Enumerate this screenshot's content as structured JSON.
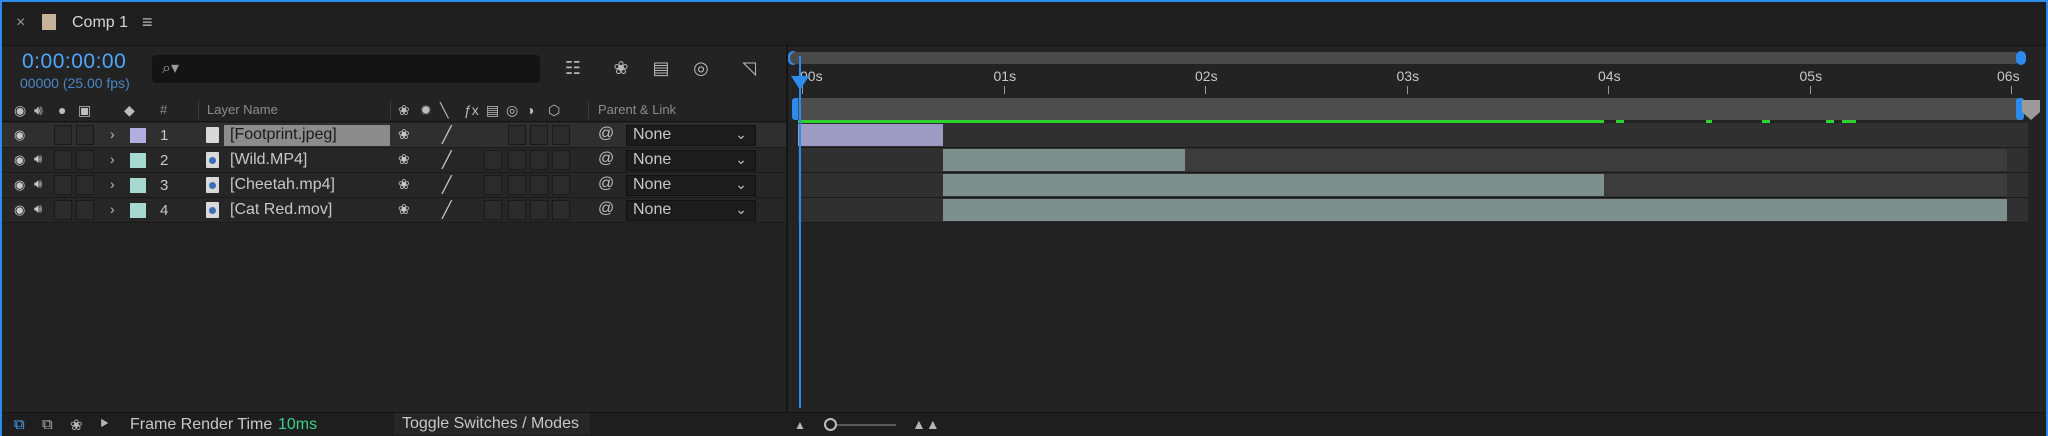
{
  "tab": {
    "close": "×",
    "title": "Comp 1",
    "menu": "≡",
    "swatch_color": "#c5b49a"
  },
  "comp": {
    "timecode": "0:00:00:00",
    "frame_info": "00000 (25.00 fps)"
  },
  "search": {
    "icon": "search-icon",
    "placeholder": ""
  },
  "columns": {
    "num": "#",
    "layer_name": "Layer Name",
    "parent_link": "Parent & Link"
  },
  "layers": [
    {
      "num": "1",
      "name": "[Footprint.jpeg]",
      "label_color": "#b3aee0",
      "parent": "None",
      "has_audio": false,
      "selected": true,
      "type": "image"
    },
    {
      "num": "2",
      "name": "[Wild.MP4]",
      "label_color": "#a6d9d0",
      "parent": "None",
      "has_audio": true,
      "selected": false,
      "type": "video"
    },
    {
      "num": "3",
      "name": "[Cheetah.mp4]",
      "label_color": "#a6d9d0",
      "parent": "None",
      "has_audio": true,
      "selected": false,
      "type": "video"
    },
    {
      "num": "4",
      "name": "[Cat Red.mov]",
      "label_color": "#a6d9d0",
      "parent": "None",
      "has_audio": true,
      "selected": false,
      "type": "video"
    }
  ],
  "ruler": {
    "labels": [
      "00s",
      "01s",
      "02s",
      "03s",
      "04s",
      "05s",
      "06s"
    ]
  },
  "tracks": [
    {
      "start": 0.0,
      "end": 0.72,
      "bar_end": 0.72,
      "color": "#9d9ac4"
    },
    {
      "start": 0.72,
      "end": 6.0,
      "bar_end": 1.92,
      "color": "#7d908d"
    },
    {
      "start": 0.72,
      "end": 6.0,
      "bar_end": 4.0,
      "color": "#7d908d"
    },
    {
      "start": 0.72,
      "end": 6.0,
      "bar_end": 6.0,
      "color": "#7d908d"
    }
  ],
  "status": {
    "frame_render_label": "Frame Render Time",
    "frame_render_value": "10ms",
    "toggle_label": "Toggle Switches / Modes"
  },
  "colors": {
    "accent": "#2d8ceb",
    "render_ok": "#2ed22e",
    "timecode": "#4ea6ff"
  }
}
